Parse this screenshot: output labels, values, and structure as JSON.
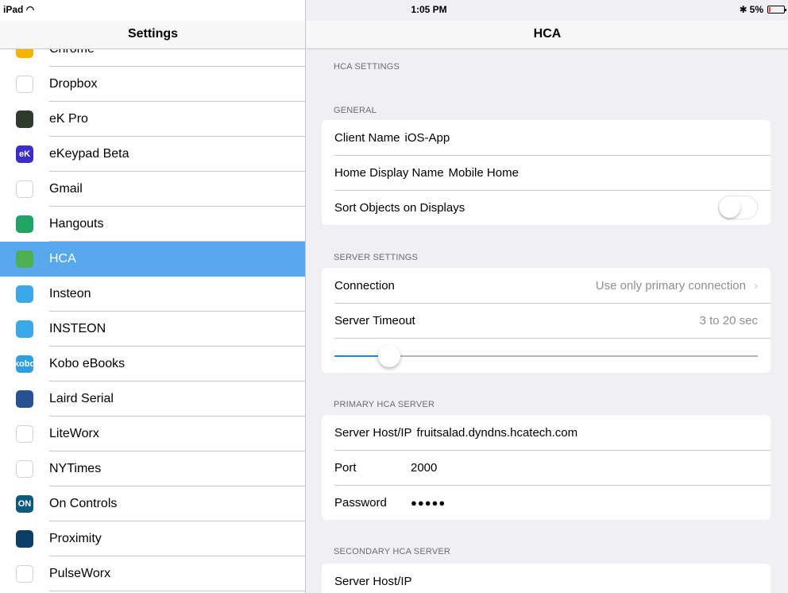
{
  "status_bar": {
    "device": "iPad",
    "time": "1:05 PM",
    "battery": "5%",
    "battery_level": 0.05
  },
  "left": {
    "title": "Settings",
    "apps": [
      {
        "label": "Chrome",
        "icon": "chrome-icon",
        "color": "#f4b400"
      },
      {
        "label": "Dropbox",
        "icon": "dropbox-icon",
        "color": "#ffffff"
      },
      {
        "label": "eK Pro",
        "icon": "ek-pro-icon",
        "color": "#2f3a2f"
      },
      {
        "label": "eKeypad Beta",
        "icon": "ekeypad-icon",
        "color": "#3b2dc9",
        "glyph": "eK"
      },
      {
        "label": "Gmail",
        "icon": "gmail-icon",
        "color": "#ffffff"
      },
      {
        "label": "Hangouts",
        "icon": "hangouts-icon",
        "color": "#1fa463"
      },
      {
        "label": "HCA",
        "icon": "hca-icon",
        "color": "#4cb050",
        "selected": true
      },
      {
        "label": "Insteon",
        "icon": "insteon-icon",
        "color": "#3ba9e8"
      },
      {
        "label": "INSTEON",
        "icon": "insteon-caps-icon",
        "color": "#3ba9e8"
      },
      {
        "label": "Kobo eBooks",
        "icon": "kobo-icon",
        "color": "#2f9fe3",
        "glyph": "kobo"
      },
      {
        "label": "Laird Serial",
        "icon": "laird-serial-icon",
        "color": "#26528f"
      },
      {
        "label": "LiteWorx",
        "icon": "liteworx-icon",
        "color": "#ffffff"
      },
      {
        "label": "NYTimes",
        "icon": "nytimes-icon",
        "color": "#ffffff"
      },
      {
        "label": "On Controls",
        "icon": "on-controls-icon",
        "color": "#0e5a7f",
        "glyph": "ON"
      },
      {
        "label": "Proximity",
        "icon": "proximity-icon",
        "color": "#0b3d66"
      },
      {
        "label": "PulseWorx",
        "icon": "pulseworx-icon",
        "color": "#ffffff"
      }
    ]
  },
  "right": {
    "title": "HCA",
    "sections": {
      "hca_settings": "HCA SETTINGS",
      "general": "GENERAL",
      "server_settings": "SERVER SETTINGS",
      "primary": "PRIMARY HCA SERVER",
      "secondary": "SECONDARY HCA SERVER"
    },
    "general": {
      "client_name_label": "Client Name",
      "client_name_value": "iOS-App",
      "home_display_label": "Home Display Name",
      "home_display_value": "Mobile Home",
      "sort_label": "Sort Objects on Displays",
      "sort_on": false
    },
    "server": {
      "connection_label": "Connection",
      "connection_value": "Use only primary connection",
      "timeout_label": "Server Timeout",
      "timeout_value": "3 to 20 sec",
      "timeout_slider_fraction": 0.13
    },
    "primary": {
      "host_label": "Server Host/IP",
      "host_value": "fruitsalad.dyndns.hcatech.com",
      "port_label": "Port",
      "port_value": "2000",
      "password_label": "Password",
      "password_value": "●●●●●"
    },
    "secondary": {
      "host_label": "Server Host/IP"
    }
  }
}
